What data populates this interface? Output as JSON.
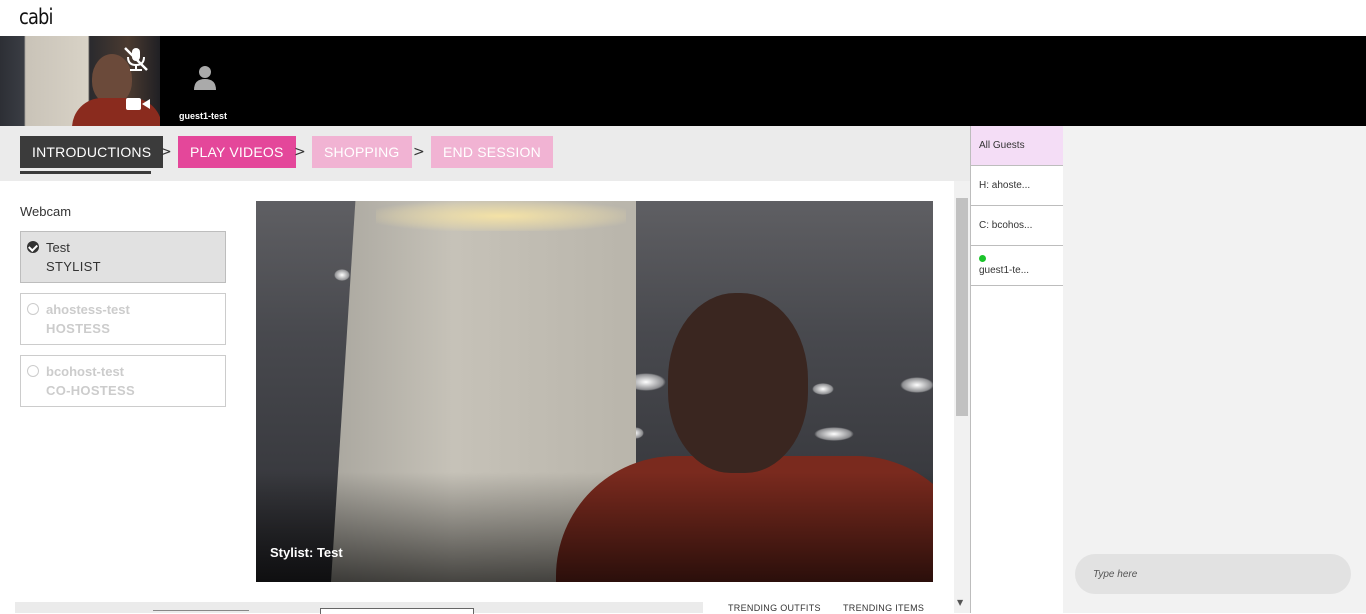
{
  "app": {
    "logo_text": "cabi"
  },
  "participants_strip": {
    "self": {
      "mic_icon": "mic-off-icon",
      "camera_icon": "video-camera-icon"
    },
    "guest": {
      "avatar_icon": "user-avatar-icon",
      "name": "guest1-test"
    }
  },
  "steps": [
    {
      "label": "INTRODUCTIONS",
      "state": "active",
      "color": "#3b3b3b"
    },
    {
      "label": "PLAY VIDEOS",
      "state": "available",
      "color": "#e4479a"
    },
    {
      "label": "SHOPPING",
      "state": "disabled",
      "color": "#f1b3d3"
    },
    {
      "label": "END SESSION",
      "state": "disabled",
      "color": "#f1b3d3"
    }
  ],
  "step_separator": ">",
  "webcam": {
    "label": "Webcam",
    "people": [
      {
        "name": "Test",
        "role": "STYLIST",
        "selected": true
      },
      {
        "name": "ahostess-test",
        "role": "HOSTESS",
        "selected": false
      },
      {
        "name": "bcohost-test",
        "role": "CO-HOSTESS",
        "selected": false
      }
    ]
  },
  "video": {
    "caption": "Stylist: Test"
  },
  "bottom_tabs": {
    "trending_outfits": "TRENDING OUTFITS",
    "trending_items": "TRENDING ITEMS"
  },
  "guest_list": [
    {
      "label": "All Guests",
      "selected": true,
      "online": false
    },
    {
      "label": "H: ahoste...",
      "selected": false,
      "online": false
    },
    {
      "label": "C: bcohos...",
      "selected": false,
      "online": false
    },
    {
      "label": "guest1-te...",
      "selected": false,
      "online": true
    }
  ],
  "chat": {
    "placeholder": "Type here"
  },
  "colors": {
    "accent_pink": "#e4479a",
    "light_pink": "#f1b3d3",
    "selected_guest_bg": "#f4ddf6",
    "online_green": "#1bc42b"
  }
}
